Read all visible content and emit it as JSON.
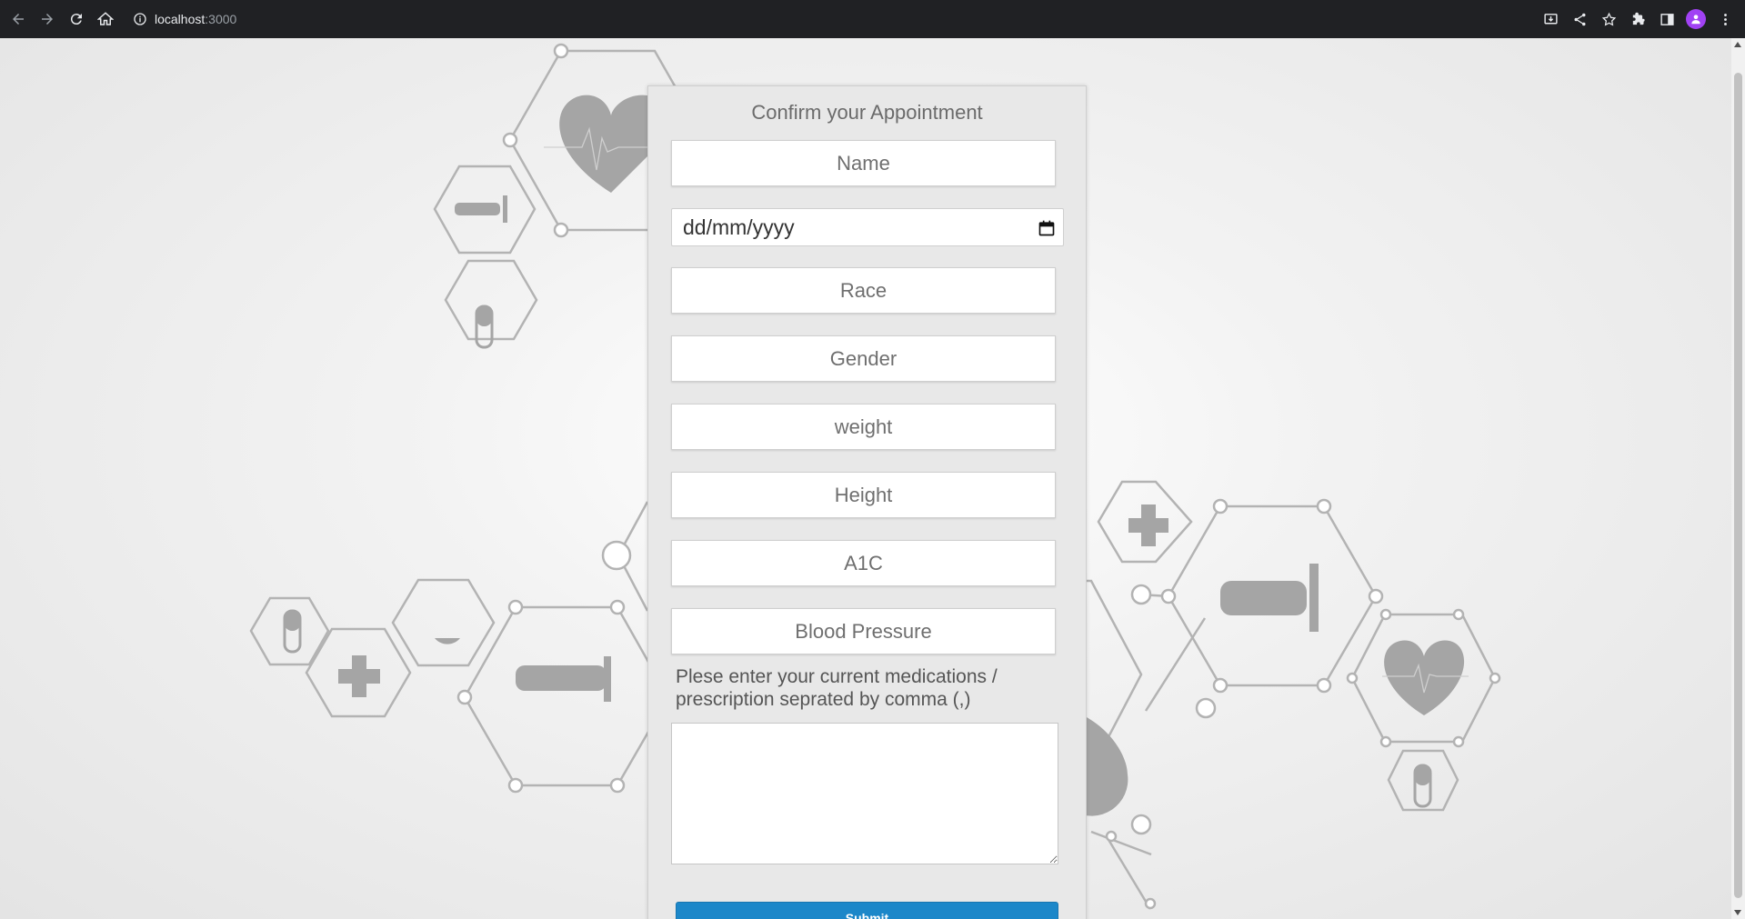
{
  "browser": {
    "url_host": "localhost",
    "url_port": ":3000"
  },
  "form": {
    "title": "Confirm your Appointment",
    "name_placeholder": "Name",
    "date_placeholder": "dd/mm/yyyy",
    "race_placeholder": "Race",
    "gender_placeholder": "Gender",
    "weight_placeholder": "weight",
    "height_placeholder": "Height",
    "a1c_placeholder": "A1C",
    "bp_placeholder": "Blood Pressure",
    "medications_label": "Plese enter your current medications / prescription seprated by comma (,)",
    "medications_value": "",
    "submit_label": "Submit"
  },
  "colors": {
    "accent": "#1c87c9",
    "chrome_bg": "#202124"
  }
}
